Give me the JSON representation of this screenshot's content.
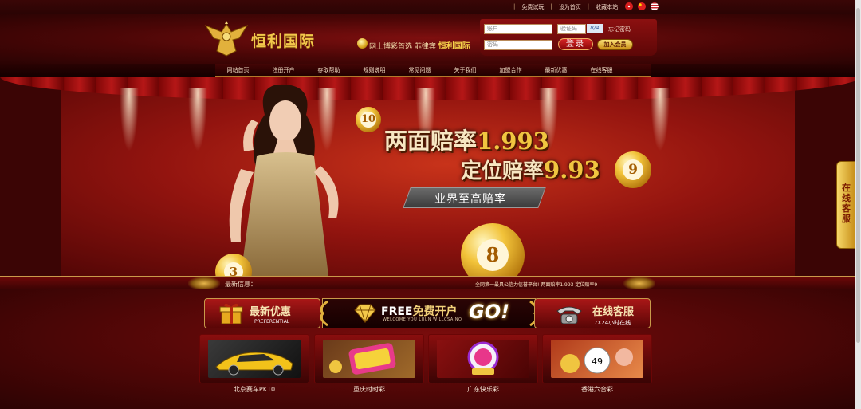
{
  "topbar": {
    "links": [
      "免费试玩",
      "设为首页",
      "收藏本站"
    ],
    "flags": [
      {
        "name": "hk-flag",
        "color": "#d81e1e"
      },
      {
        "name": "cn-flag",
        "color": "#e02020"
      },
      {
        "name": "us-flag",
        "color": "#3a5aa8"
      }
    ]
  },
  "header": {
    "logo_text": "恒利国际",
    "slogan_prefix": "网上博彩首选  菲律宾",
    "slogan_brand": "恒利国际"
  },
  "login": {
    "account_placeholder": "账户",
    "password_placeholder": "密码",
    "captcha_placeholder": "验证码",
    "captcha_code": "8/4",
    "forgot_label": "忘记密码",
    "login_label": "登录",
    "join_label": "加入会员"
  },
  "nav": {
    "items": [
      "网站首页",
      "注册开户",
      "存取帮助",
      "规则说明",
      "常见问题",
      "关于我们",
      "加盟合作",
      "最新优惠",
      "在线客服"
    ]
  },
  "banner": {
    "line1_label": "两面赔率",
    "line1_value": "1.993",
    "line2_label": "定位赔率",
    "line2_value": "9.93",
    "tagline": "业界至高赔率",
    "ball_10": "10",
    "ball_9": "9",
    "ball_8": "8",
    "ball_3": "3"
  },
  "ticker": {
    "label": "最新信息：",
    "text": "全网第一最具公信力信誉平台!  两面赔率1.993 定位赔率9"
  },
  "promos": {
    "left_title": "最新优惠",
    "left_sub": "PREFERENTIAL",
    "free_title_en": "FREE",
    "free_title_cn": "免费开户",
    "free_sub": "WELCOME YOU LIJUN WILLCSAINO",
    "free_go": "GO!",
    "right_title": "在线客服",
    "right_sub": "7X24小时在线"
  },
  "games": [
    {
      "label": "北京赛车PK10"
    },
    {
      "label": "重庆时时彩"
    },
    {
      "label": "广东快乐彩"
    },
    {
      "label": "香港六合彩"
    }
  ],
  "side_service": {
    "label": "在线客服"
  },
  "colors": {
    "gold": "#f0c540",
    "deep_red": "#5a0a0a"
  }
}
